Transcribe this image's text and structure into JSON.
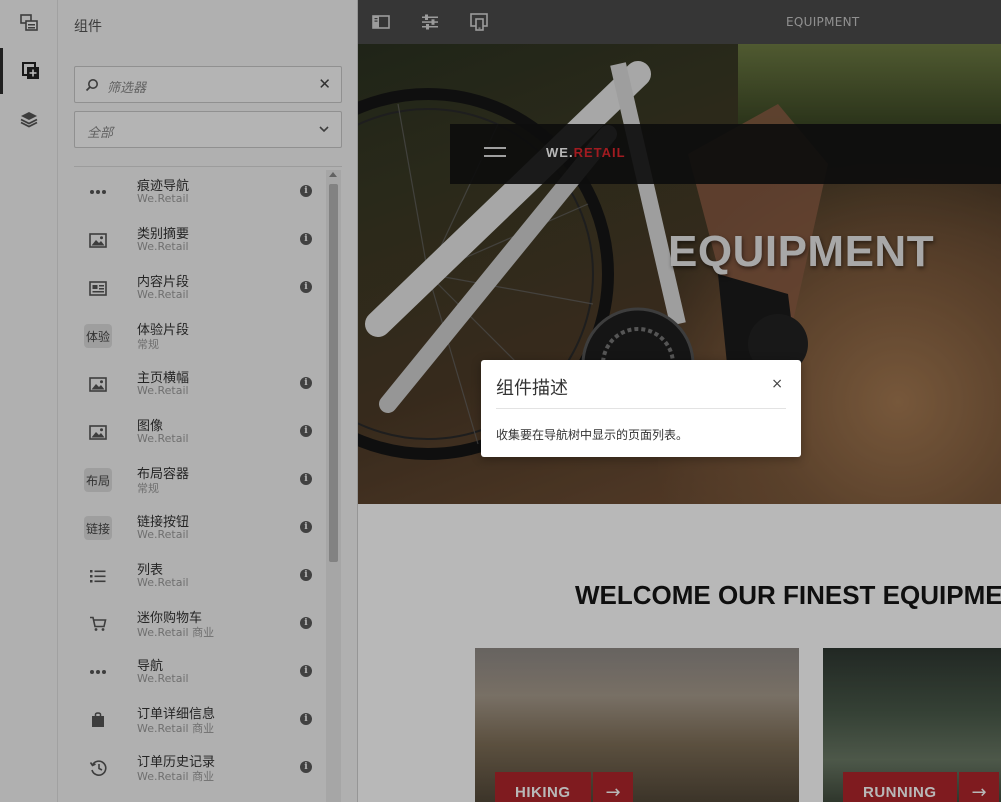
{
  "panel": {
    "title": "组件",
    "filter_placeholder": "筛选器",
    "group_select_value": "全部",
    "components": [
      {
        "name": "痕迹导航",
        "group": "We.Retail",
        "icon": "more-horizontal-icon",
        "badge": ""
      },
      {
        "name": "类别摘要",
        "group": "We.Retail",
        "icon": "image-icon",
        "badge": ""
      },
      {
        "name": "内容片段",
        "group": "We.Retail",
        "icon": "content-fragment-icon",
        "badge": ""
      },
      {
        "name": "体验片段",
        "group": "常规",
        "icon": "",
        "badge": "体验"
      },
      {
        "name": "主页横幅",
        "group": "We.Retail",
        "icon": "image-icon",
        "badge": ""
      },
      {
        "name": "图像",
        "group": "We.Retail",
        "icon": "image-icon",
        "badge": ""
      },
      {
        "name": "布局容器",
        "group": "常规",
        "icon": "",
        "badge": "布局"
      },
      {
        "name": "链接按钮",
        "group": "We.Retail",
        "icon": "",
        "badge": "链接"
      },
      {
        "name": "列表",
        "group": "We.Retail",
        "icon": "list-icon",
        "badge": ""
      },
      {
        "name": "迷你购物车",
        "group": "We.Retail 商业",
        "icon": "cart-icon",
        "badge": ""
      },
      {
        "name": "导航",
        "group": "We.Retail",
        "icon": "more-horizontal-icon",
        "badge": ""
      },
      {
        "name": "订单详细信息",
        "group": "We.Retail 商业",
        "icon": "shopping-bag-icon",
        "badge": ""
      },
      {
        "name": "订单历史记录",
        "group": "We.Retail 商业",
        "icon": "history-icon",
        "badge": ""
      }
    ]
  },
  "topbar": {
    "title": "EQUIPMENT"
  },
  "site": {
    "brand_prefix": "WE.",
    "brand_suffix": "RETAIL",
    "hero_title": "EQUIPMENT",
    "welcome": "WELCOME OUR FINEST EQUIPMENT",
    "cards": [
      {
        "label": "HIKING",
        "arrow": "→"
      },
      {
        "label": "RUNNING",
        "arrow": "→"
      }
    ]
  },
  "dialog": {
    "title": "组件描述",
    "close": "×",
    "body": "收集要在导航树中显示的页面列表。"
  },
  "colors": {
    "brand_red": "#e0262d",
    "card_red": "#b0262b",
    "topbar": "#4b4b4b",
    "panel_bg": "#f4f4f4"
  }
}
